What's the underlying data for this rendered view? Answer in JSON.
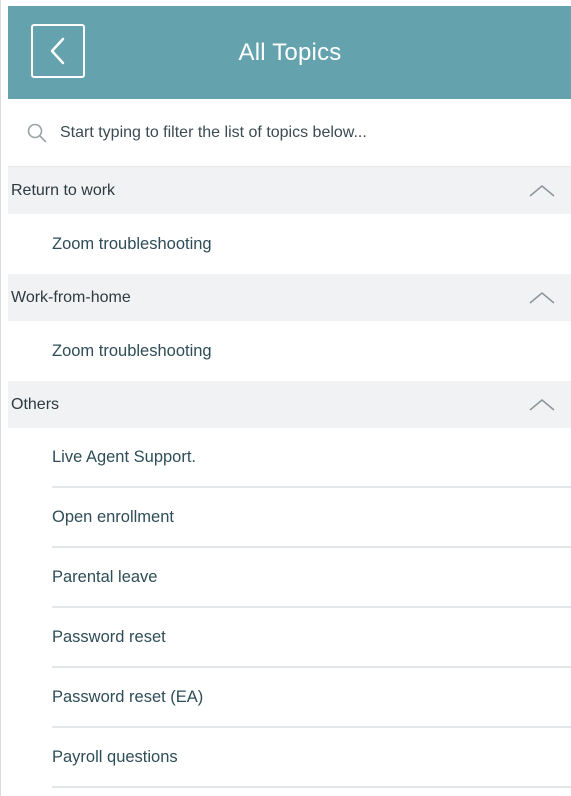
{
  "header": {
    "title": "All Topics"
  },
  "search": {
    "placeholder": "Start typing to filter the list of topics below..."
  },
  "sections": [
    {
      "title": "Return to work",
      "items": [
        "Zoom troubleshooting"
      ]
    },
    {
      "title": "Work-from-home",
      "items": [
        "Zoom troubleshooting"
      ]
    },
    {
      "title": "Others",
      "items": [
        "Live Agent Support.",
        "Open enrollment",
        "Parental leave",
        "Password reset",
        "Password reset (EA)",
        "Payroll questions"
      ]
    }
  ],
  "colors": {
    "header_bg": "#64a3ae",
    "section_bg": "#f1f2f4",
    "item_text": "#2e4d57"
  },
  "icons": {
    "back": "chevron-left-icon",
    "search": "search-icon",
    "collapse": "chevron-up-icon"
  }
}
